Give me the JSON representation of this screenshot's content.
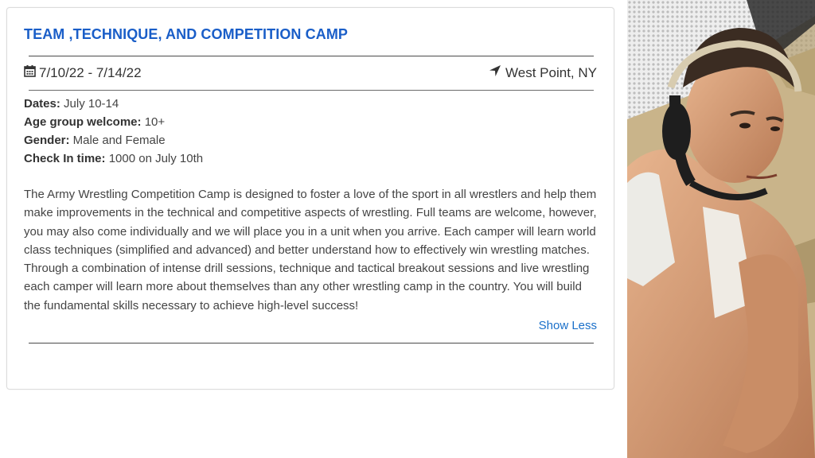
{
  "camp": {
    "title": "TEAM ,TECHNIQUE, AND COMPETITION CAMP",
    "date_range": "7/10/22 - 7/14/22",
    "location": "West Point, NY",
    "details": [
      {
        "label": "Dates:",
        "value": " July 10-14"
      },
      {
        "label": "Age group welcome:",
        "value": " 10+"
      },
      {
        "label": "Gender:",
        "value": " Male and Female"
      },
      {
        "label": "Check In time:",
        "value": " 1000 on July 10th"
      }
    ],
    "description": "The Army Wrestling Competition Camp is designed to foster a love of the sport in all wrestlers and help them make improvements in the technical and competitive aspects of wrestling. Full teams are welcome, however, you may also come individually and we will place you in a unit when you arrive. Each camper will learn world class techniques (simplified and advanced) and better understand how to effectively win wrestling matches. Through a combination of intense drill sessions, technique and tactical breakout sessions and live wrestling each camper will learn more about themselves than any other wrestling camp in the country. You will build the fundamental skills necessary to achieve high-level success!",
    "toggle_label": "Show Less"
  },
  "icons": {
    "date": "calendar-icon",
    "location": "location-arrow-icon"
  },
  "colors": {
    "title": "#1a5ec8",
    "link": "#1a6fc9",
    "camo_base": "#c9b48a"
  }
}
